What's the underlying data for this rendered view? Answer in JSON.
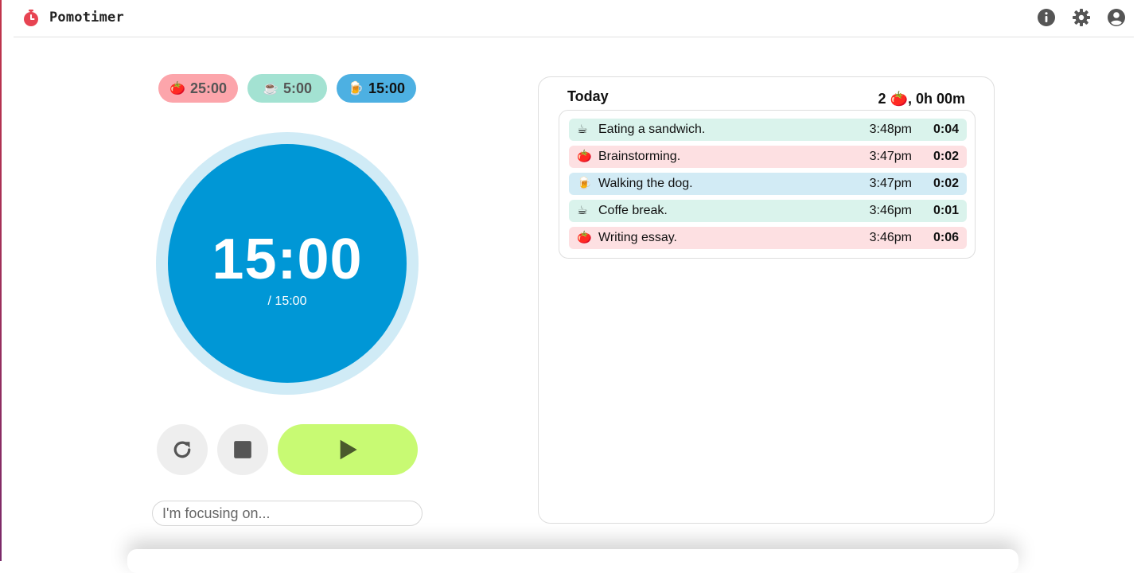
{
  "app": {
    "title": "Pomotimer"
  },
  "modes": [
    {
      "emoji": "🍅",
      "label": "25:00",
      "bg": "#fca5ab",
      "fg": "#555555"
    },
    {
      "emoji": "☕",
      "label": "5:00",
      "bg": "#a3e2d2",
      "fg": "#555555"
    },
    {
      "emoji": "🍺",
      "label": "15:00",
      "bg": "#4db0e2",
      "fg": "#111111"
    }
  ],
  "timer": {
    "remaining": "15:00",
    "total": "/ 15:00",
    "color": "#0097d6",
    "ring": "#d0ebf6"
  },
  "focus": {
    "placeholder": "I'm focusing on...",
    "value": ""
  },
  "today": {
    "title": "Today",
    "summary_count": "2",
    "summary_emoji": "🍅",
    "summary_time": ", 0h 00m",
    "entries": [
      {
        "emoji": "☕",
        "task": "Eating a sandwich.",
        "time": "3:48pm",
        "duration": "0:04",
        "bg": "#daf3ec"
      },
      {
        "emoji": "🍅",
        "task": "Brainstorming.",
        "time": "3:47pm",
        "duration": "0:02",
        "bg": "#fde0e2"
      },
      {
        "emoji": "🍺",
        "task": "Walking the dog.",
        "time": "3:47pm",
        "duration": "0:02",
        "bg": "#d2ebf5"
      },
      {
        "emoji": "☕",
        "task": "Coffe break.",
        "time": "3:46pm",
        "duration": "0:01",
        "bg": "#daf3ec"
      },
      {
        "emoji": "🍅",
        "task": "Writing essay.",
        "time": "3:46pm",
        "duration": "0:06",
        "bg": "#fde0e2"
      }
    ]
  },
  "colors": {
    "play": "#c8fa73",
    "play_icon": "#4a5a2c",
    "ctrl_bg": "#eeeeee",
    "ctrl_icon": "#555555",
    "accent_red": "#e74452"
  },
  "icons": {
    "logo": "stopwatch-icon",
    "info": "info-icon",
    "settings": "gear-icon",
    "account": "account-icon",
    "reset": "restart-icon",
    "stop": "stop-icon",
    "play": "play-icon"
  }
}
